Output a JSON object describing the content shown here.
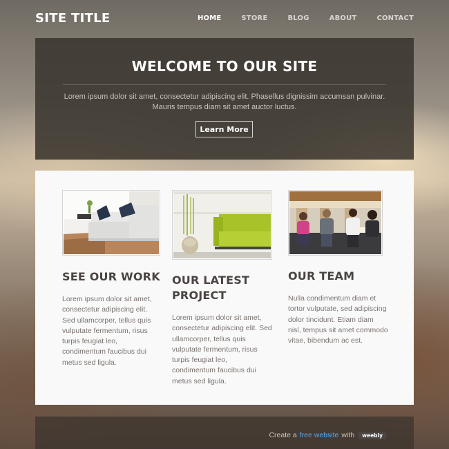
{
  "header": {
    "site_title": "SITE TITLE",
    "nav": [
      "HOME",
      "STORE",
      "BLOG",
      "ABOUT",
      "CONTACT"
    ],
    "active_nav": "HOME"
  },
  "hero": {
    "title": "WELCOME TO OUR SITE",
    "text": "Lorem ipsum dolor sit amet, consectetur adipiscing elit. Phasellus dignissim accumsan pulvinar. Mauris tempus diam sit amet auctor luctus.",
    "button": "Learn More"
  },
  "columns": [
    {
      "image": "living-room-sofa-photo",
      "heading": "SEE OUR WORK",
      "text": "Lorem ipsum dolor sit amet, consectetur adipiscing elit. Sed ullamcorper, tellus quis vulputate fermentum, risus turpis feugiat leo, condimentum faucibus dui metus sed ligula."
    },
    {
      "image": "green-sofa-vase-photo",
      "heading": "OUR LATEST PROJECT",
      "text": "Lorem ipsum dolor sit amet, consectetur adipiscing elit. Sed ullamcorper, tellus quis vulputate fermentum, risus turpis feugiat leo, condimentum faucibus dui metus sed ligula."
    },
    {
      "image": "team-meeting-photo",
      "heading": "OUR TEAM",
      "text": "Nulla condimentum diam et tortor vulputate, sed adipiscing dolor tincidunt. Etiam diam nisl, tempus sit amet commodo vitae, bibendum ac est."
    }
  ],
  "footer": {
    "prefix": "Create a",
    "link": "free website",
    "suffix": "with",
    "badge": "weebly"
  },
  "colors": {
    "hero_bg": "#3a352f",
    "content_bg": "#f9f9f9",
    "heading": "#4a4442",
    "body_text": "#7a7370",
    "link": "#5aa8e6"
  }
}
